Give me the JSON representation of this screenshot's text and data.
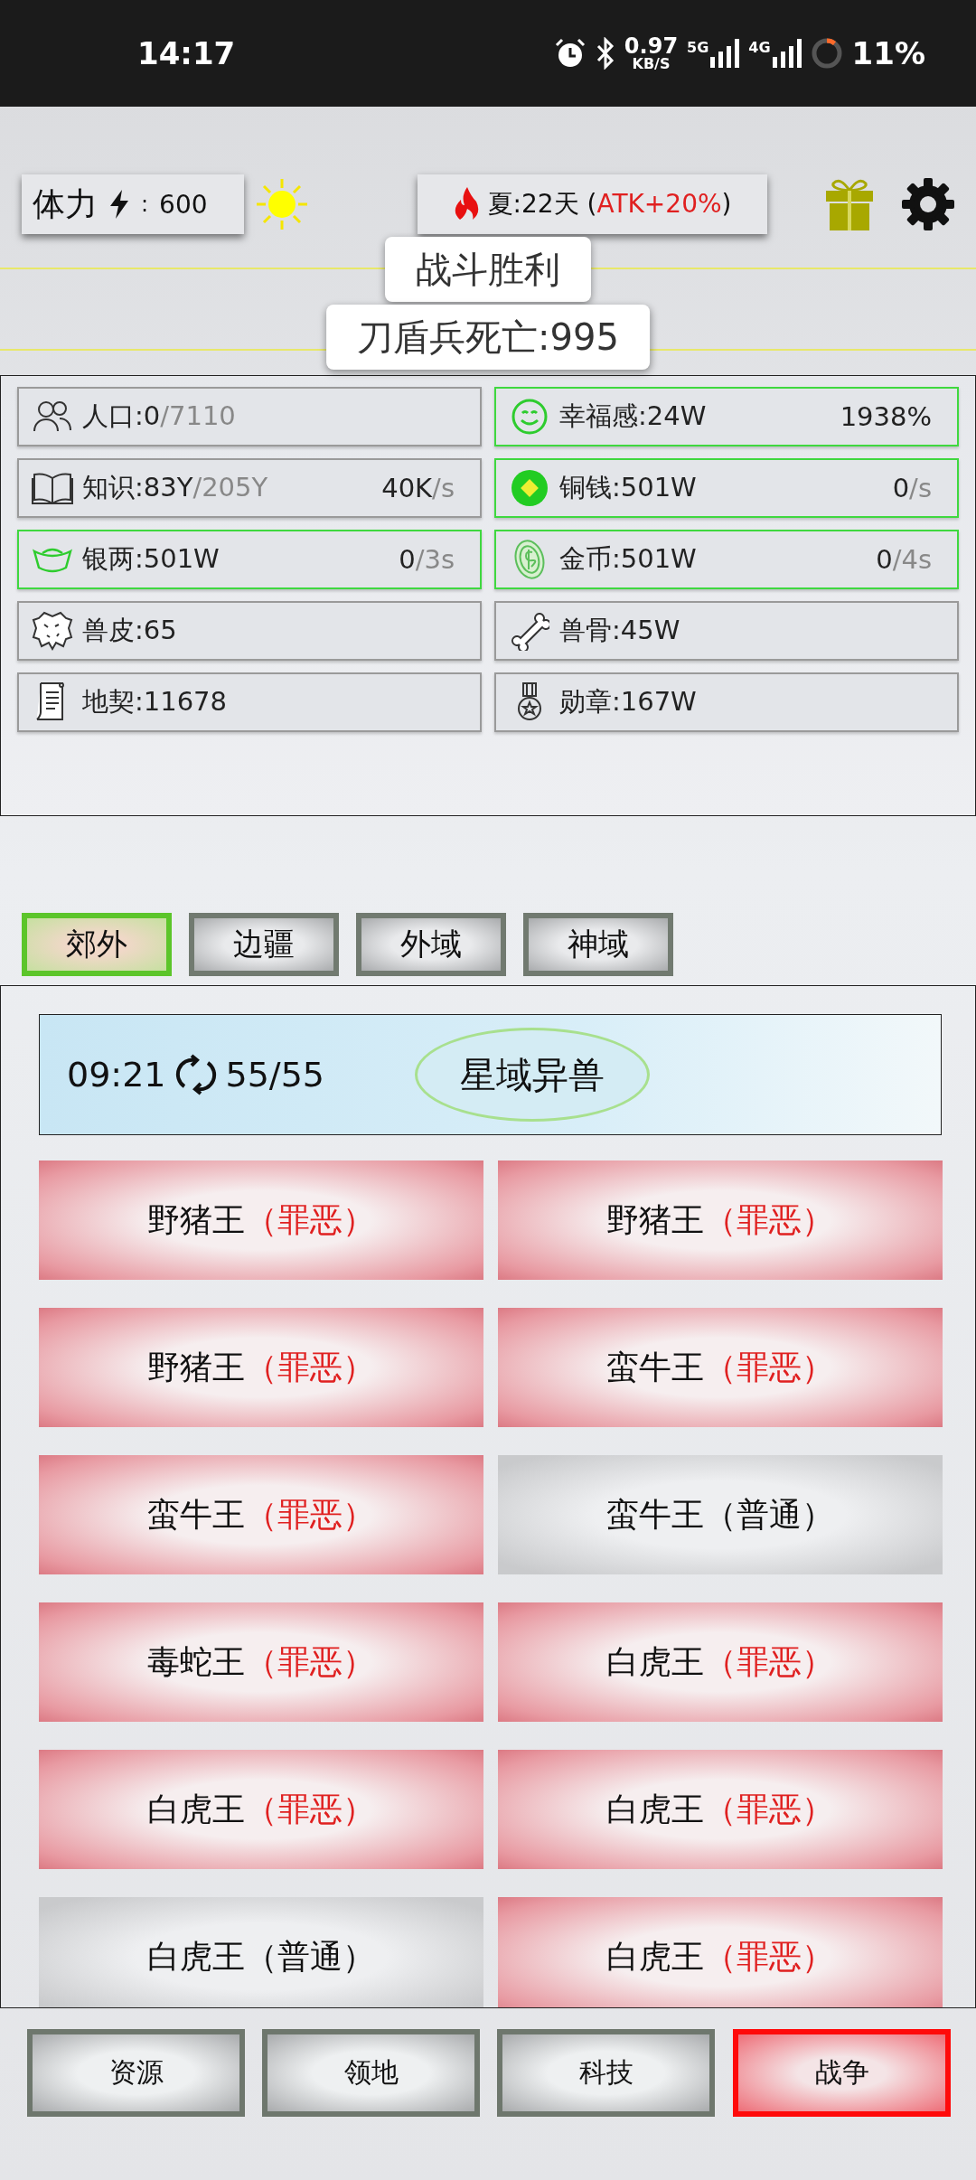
{
  "status_bar": {
    "time": "14:17",
    "net_speed": "0.97",
    "net_unit": "KB/S",
    "net_5g": "5G",
    "net_4g": "4G",
    "battery": "11%"
  },
  "header": {
    "stamina_label": "体力",
    "stamina_sep": ":",
    "stamina_value": "600",
    "season": "夏:22天 ",
    "paren_open": "(",
    "bonus": "ATK+20%",
    "paren_close": ")"
  },
  "toasts": [
    "战斗胜利",
    "刀盾兵死亡:995"
  ],
  "resources": [
    {
      "kind": "people",
      "text": "人口:0",
      "sub": "/7110",
      "highlighted": false
    },
    {
      "kind": "smile",
      "text": "幸福感:24W",
      "rate": "1938%",
      "highlighted": true
    },
    {
      "kind": "book",
      "text": "知识:83Y",
      "sub": "/205Y",
      "rate": "40K",
      "rate_unit": "/s",
      "highlighted": false
    },
    {
      "kind": "copper",
      "text": "铜钱:501W",
      "rate": "0",
      "rate_unit": "/s",
      "highlighted": true
    },
    {
      "kind": "ingot",
      "text": "银两:501W",
      "rate": "0",
      "rate_unit": "/3s",
      "highlighted": true
    },
    {
      "kind": "gold",
      "text": "金币:501W",
      "rate": "0",
      "rate_unit": "/4s",
      "highlighted": true
    },
    {
      "kind": "hide",
      "text": "兽皮:65",
      "highlighted": false
    },
    {
      "kind": "bone",
      "text": "兽骨:45W",
      "highlighted": false
    },
    {
      "kind": "scroll",
      "text": "地契:11678",
      "highlighted": false
    },
    {
      "kind": "medal",
      "text": "勋章:167W",
      "highlighted": false
    }
  ],
  "tabs": [
    {
      "label": "郊外",
      "selected": true
    },
    {
      "label": "边疆",
      "selected": false
    },
    {
      "label": "外域",
      "selected": false
    },
    {
      "label": "神域",
      "selected": false
    }
  ],
  "banner": {
    "timer": "09:21",
    "count": "55/55",
    "button": "星域异兽"
  },
  "enemies": [
    {
      "name": "野猪王",
      "tier": "（罪恶）",
      "kind": "evil"
    },
    {
      "name": "野猪王",
      "tier": "（罪恶）",
      "kind": "evil"
    },
    {
      "name": "野猪王",
      "tier": "（罪恶）",
      "kind": "evil"
    },
    {
      "name": "蛮牛王",
      "tier": "（罪恶）",
      "kind": "evil"
    },
    {
      "name": "蛮牛王",
      "tier": "（罪恶）",
      "kind": "evil"
    },
    {
      "name": "蛮牛王",
      "tier": "（普通）",
      "kind": "normal"
    },
    {
      "name": "毒蛇王",
      "tier": "（罪恶）",
      "kind": "evil"
    },
    {
      "name": "白虎王",
      "tier": "（罪恶）",
      "kind": "evil"
    },
    {
      "name": "白虎王",
      "tier": "（罪恶）",
      "kind": "evil"
    },
    {
      "name": "白虎王",
      "tier": "（罪恶）",
      "kind": "evil"
    },
    {
      "name": "白虎王",
      "tier": "（普通）",
      "kind": "normal"
    },
    {
      "name": "白虎王",
      "tier": "（罪恶）",
      "kind": "evil"
    }
  ],
  "bottom_nav": [
    {
      "label": "资源",
      "selected": false
    },
    {
      "label": "领地",
      "selected": false
    },
    {
      "label": "科技",
      "selected": false
    },
    {
      "label": "战争",
      "selected": true
    }
  ]
}
